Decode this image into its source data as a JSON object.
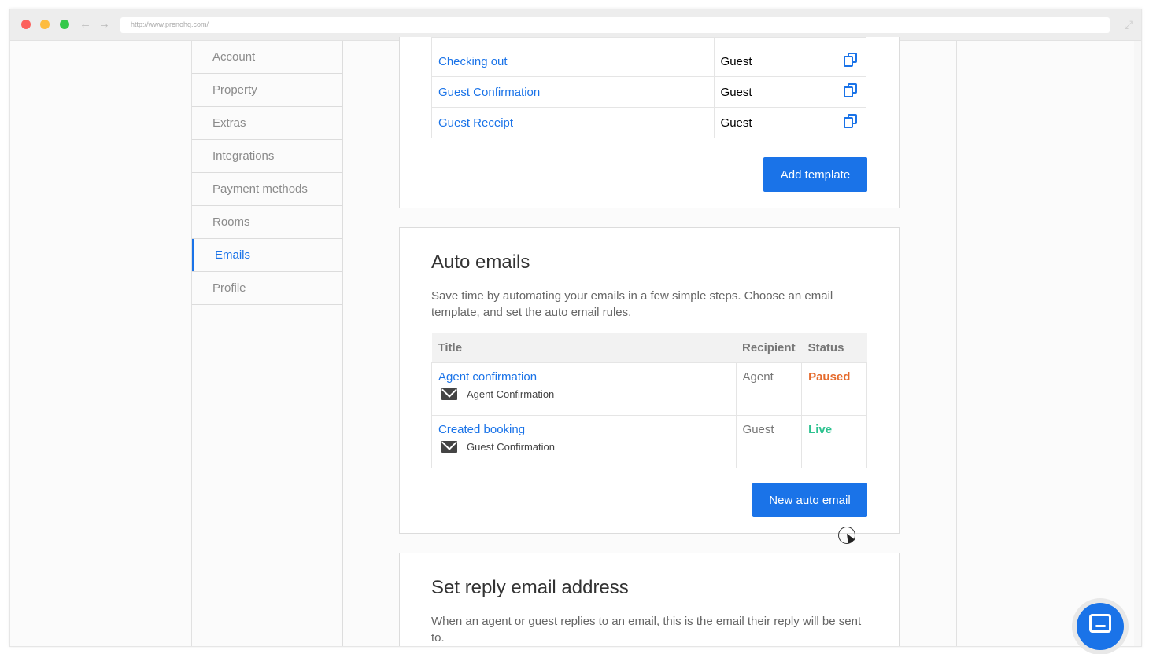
{
  "browser": {
    "url": "http://www.prenohq.com/"
  },
  "sidebar": {
    "items": [
      {
        "label": "Account"
      },
      {
        "label": "Property"
      },
      {
        "label": "Extras"
      },
      {
        "label": "Integrations"
      },
      {
        "label": "Payment methods"
      },
      {
        "label": "Rooms"
      },
      {
        "label": "Emails",
        "active": true
      },
      {
        "label": "Profile"
      }
    ]
  },
  "templates": {
    "rows": [
      {
        "name": "Checking out",
        "recipient": "Guest"
      },
      {
        "name": "Guest Confirmation",
        "recipient": "Guest"
      },
      {
        "name": "Guest Receipt",
        "recipient": "Guest"
      }
    ],
    "add_button": "Add template"
  },
  "auto_emails": {
    "title": "Auto emails",
    "description": "Save time by automating your emails in a few simple steps. Choose an email template, and set the auto email rules.",
    "columns": [
      "Title",
      "Recipient",
      "Status"
    ],
    "rows": [
      {
        "title": "Agent confirmation",
        "template": "Agent Confirmation",
        "recipient": "Agent",
        "status": "Paused"
      },
      {
        "title": "Created booking",
        "template": "Guest Confirmation",
        "recipient": "Guest",
        "status": "Live"
      }
    ],
    "new_button": "New auto email"
  },
  "reply_email": {
    "title": "Set reply email address",
    "description": "When an agent or guest replies to an email, this is the email their reply will be sent to."
  },
  "colors": {
    "accent": "#1a73e8",
    "paused": "#e56a2c",
    "live": "#2cc28f"
  },
  "icons": {
    "copy": "copy-icon",
    "mail": "mail-icon",
    "chat": "chat-icon"
  }
}
